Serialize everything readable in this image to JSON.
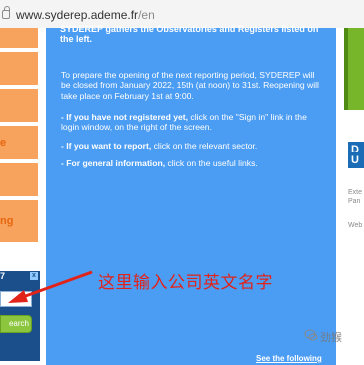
{
  "browser": {
    "url_host": "www.syderep.ademe.fr",
    "url_path": "/en"
  },
  "left_nav": {
    "tab_items": [
      "",
      "",
      "",
      "e",
      "",
      "ng"
    ],
    "login_bar_label": "7",
    "login_close": "x",
    "search_label": "earch"
  },
  "main": {
    "top_line": "SYDEREP gathers the Observatories and Registers listed on",
    "top_line_end": "the left.",
    "para1": "To prepare the opening of the next reporting period, SYDEREP will be closed from January 2022, 15th (at noon) to 31st. Reopening will take place on February 1st at 9:00.",
    "para2_bold": "- If you have not registered yet,",
    "para2_rest": " click on the \"Sign in\" link in the login window, on the right of the screen.",
    "para3_bold": "- If you want to report,",
    "para3_rest": " click on the relevant sector.",
    "para4_bold": "- For general information,",
    "para4_rest": " click on the useful links.",
    "see_following": "See the following"
  },
  "right_nav": {
    "btn1": "D",
    "btn2": "U",
    "text1": "Exte",
    "text2": "Pan",
    "text3": "Web"
  },
  "annotation": {
    "text": "这里输入公司英文名字",
    "color": "#e2231a"
  },
  "watermark": {
    "text": "劲猴"
  },
  "colors": {
    "main_blue": "#4b9cf3",
    "orange": "#f7a25d",
    "green": "#77b52a",
    "annotation_red": "#e2231a"
  }
}
